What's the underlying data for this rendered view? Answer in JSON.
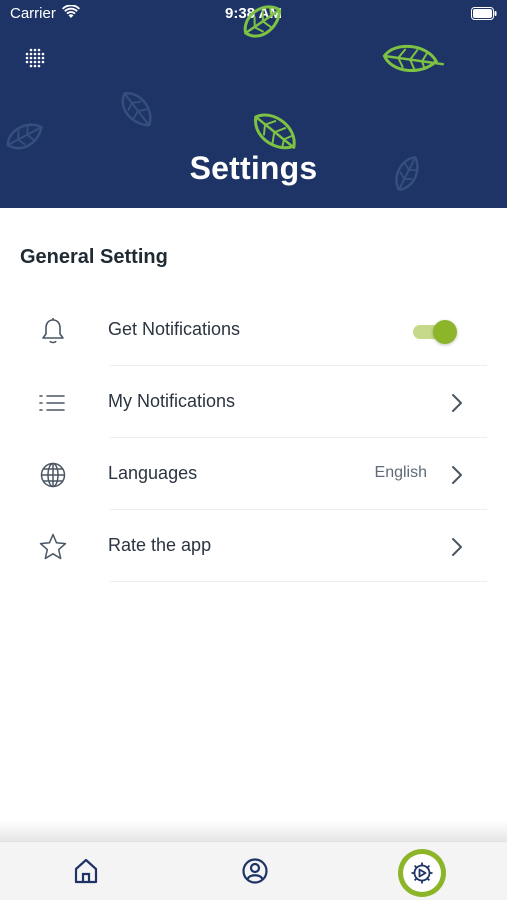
{
  "status_bar": {
    "carrier": "Carrier",
    "time": "9:38 AM",
    "icons": [
      "wifi-icon",
      "battery-icon"
    ]
  },
  "header": {
    "title": "Settings",
    "background_color": "#1f3466",
    "leaf_color": "#7dc242",
    "menu_icon": "dots-grid-icon"
  },
  "main": {
    "section_title": "General Setting",
    "rows": [
      {
        "icon": "bell-icon",
        "label": "Get Notifications",
        "control": "toggle",
        "toggle_on": true
      },
      {
        "icon": "list-icon",
        "label": "My Notifications",
        "control": "chevron-right-icon"
      },
      {
        "icon": "globe-icon",
        "label": "Languages",
        "value": "English",
        "control": "chevron-right-icon"
      },
      {
        "icon": "star-icon",
        "label": "Rate the app",
        "control": "chevron-right-icon"
      }
    ]
  },
  "tab_bar": {
    "tabs": [
      {
        "icon": "home-icon",
        "active": false
      },
      {
        "icon": "profile-icon",
        "active": false
      },
      {
        "icon": "settings-gear-icon",
        "active": true
      }
    ],
    "active_color": "#8db52a",
    "icon_color": "#1f3466"
  }
}
